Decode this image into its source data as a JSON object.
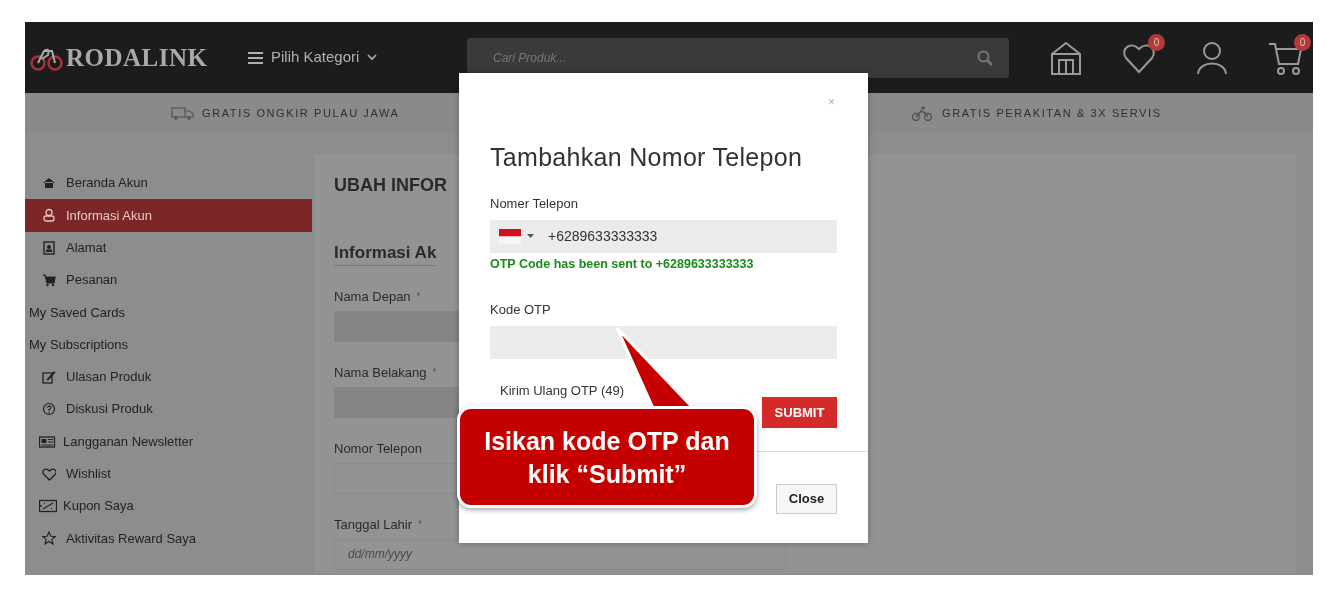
{
  "header": {
    "logo": "RODALINK",
    "category_menu": "Pilih Kategori",
    "search": {
      "placeholder": "Cari Produk..."
    },
    "icons": [
      {
        "kind": "store"
      },
      {
        "kind": "wishlist",
        "badge": "0"
      },
      {
        "kind": "account"
      },
      {
        "kind": "cart",
        "badge": "0"
      }
    ]
  },
  "promo_strip": [
    {
      "kind": "truck",
      "text": "GRATIS ONGKIR PULAU JAWA"
    },
    {
      "kind": "bike",
      "text": "GRATIS PERAKITAN & 3X SERVIS"
    }
  ],
  "sidebar": {
    "items": [
      {
        "label": "Beranda Akun",
        "kind": "home",
        "selected": false
      },
      {
        "label": "Informasi Akun",
        "kind": "user",
        "selected": true
      },
      {
        "label": "Alamat",
        "kind": "contact",
        "selected": false
      },
      {
        "label": "Pesanan",
        "kind": "cart",
        "selected": false
      },
      {
        "label": "My Saved Cards",
        "selected": false
      },
      {
        "label": "My Subscriptions",
        "selected": false
      },
      {
        "label": "Ulasan Produk",
        "kind": "edit",
        "selected": false
      },
      {
        "label": "Diskusi Produk",
        "kind": "question",
        "selected": false
      },
      {
        "label": "Langganan Newsletter",
        "kind": "newspaper",
        "selected": false
      },
      {
        "label": "Wishlist",
        "kind": "heart",
        "selected": false
      },
      {
        "label": "Kupon Saya",
        "kind": "coupon",
        "selected": false
      },
      {
        "label": "Aktivitas Reward Saya",
        "kind": "star",
        "selected": false
      }
    ]
  },
  "main": {
    "title": "UBAH INFOR",
    "section": "Informasi Ak",
    "fields": [
      {
        "label": "Nama Depan",
        "required_mark": "*",
        "disabled": true
      },
      {
        "label": "Nama Belakang",
        "required_mark": "*",
        "disabled": true
      },
      {
        "label": "Nomor Telepon",
        "disabled": false
      },
      {
        "label": "Tanggal Lahir",
        "required_mark": "*",
        "disabled": false,
        "placeholder": "dd/mm/yyyy"
      }
    ]
  },
  "modal": {
    "close": "×",
    "title": "Tambahkan Nomor Telepon",
    "phone": {
      "label": "Nomer Telepon",
      "value": "+6289633333333"
    },
    "otp_message": "OTP Code has been sent to +6289633333333",
    "otp": {
      "label": "Kode OTP"
    },
    "resend": "Kirim Ulang OTP (49)",
    "submit": "SUBMIT",
    "footer_button": "Close"
  },
  "callout": {
    "text": "Isikan kode OTP dan klik “Submit”"
  }
}
